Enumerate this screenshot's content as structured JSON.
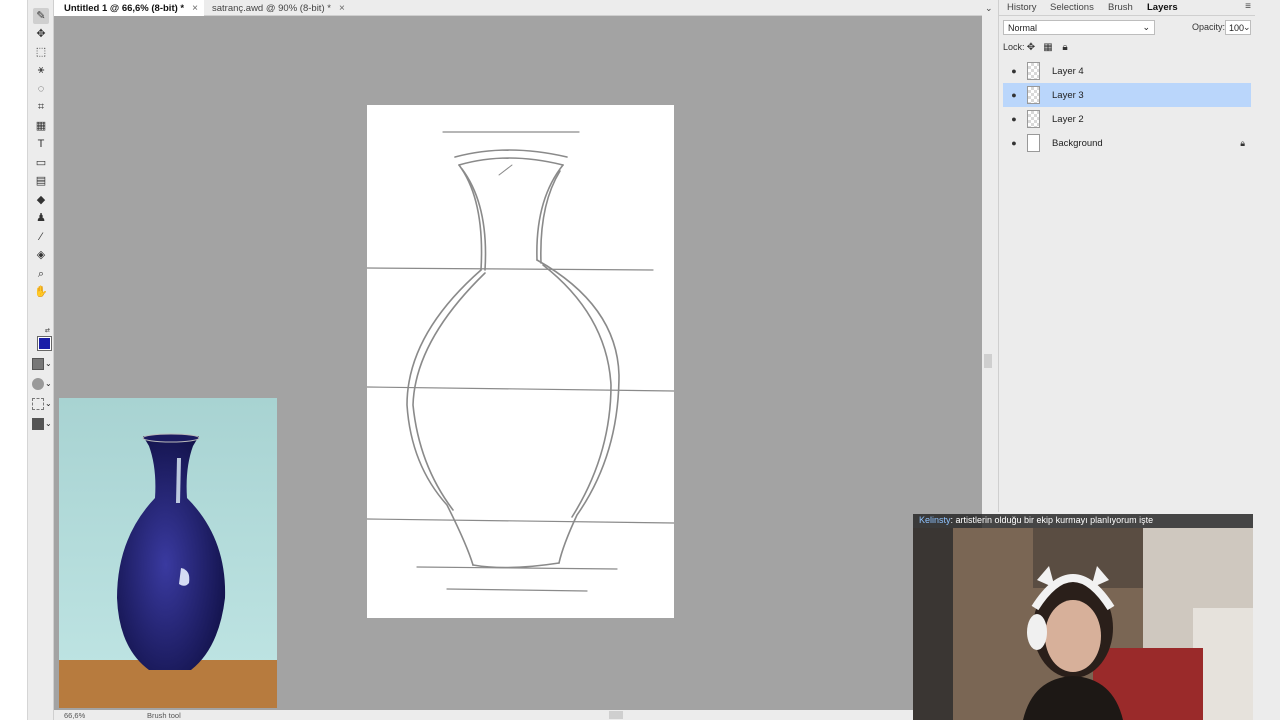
{
  "tabs": [
    {
      "label": "Untitled 1 @ 66,6% (8-bit) *",
      "close": "×"
    },
    {
      "label": "satranç.awd @ 90% (8-bit) *",
      "close": "×"
    }
  ],
  "panel": {
    "tabs": [
      "History",
      "Selections",
      "Brush",
      "Layers"
    ],
    "active_tab": "Layers",
    "blend_mode": "Normal",
    "opacity_label": "Opacity:",
    "opacity_value": "100",
    "lock_label": "Lock:",
    "layers": [
      {
        "name": "Layer 4",
        "visible": true,
        "selected": false,
        "locked": false
      },
      {
        "name": "Layer 3",
        "visible": true,
        "selected": true,
        "locked": false
      },
      {
        "name": "Layer 2",
        "visible": true,
        "selected": false,
        "locked": false
      },
      {
        "name": "Background",
        "visible": true,
        "selected": false,
        "locked": true
      }
    ]
  },
  "status": {
    "zoom": "66,6%",
    "tool": "Brush tool"
  },
  "colors": {
    "foreground": "#1a1ea8",
    "background": "#ffffff",
    "selection": "#bad6fb",
    "canvas_bg": "#a3a3a3"
  },
  "chat": {
    "user": "Kelinsty",
    "message": ": artistlerin olduğu bir ekip kurmayı planlıyorum işte"
  },
  "icons": [
    "brush-icon",
    "move-icon",
    "marquee-icon",
    "magic-wand-icon",
    "lasso-icon",
    "crop-icon",
    "slice-icon",
    "text-icon",
    "shape-icon",
    "gradient-icon",
    "eraser-icon",
    "stamp-icon",
    "eyedropper-icon",
    "paint-bucket-icon",
    "zoom-icon",
    "hand-icon"
  ]
}
